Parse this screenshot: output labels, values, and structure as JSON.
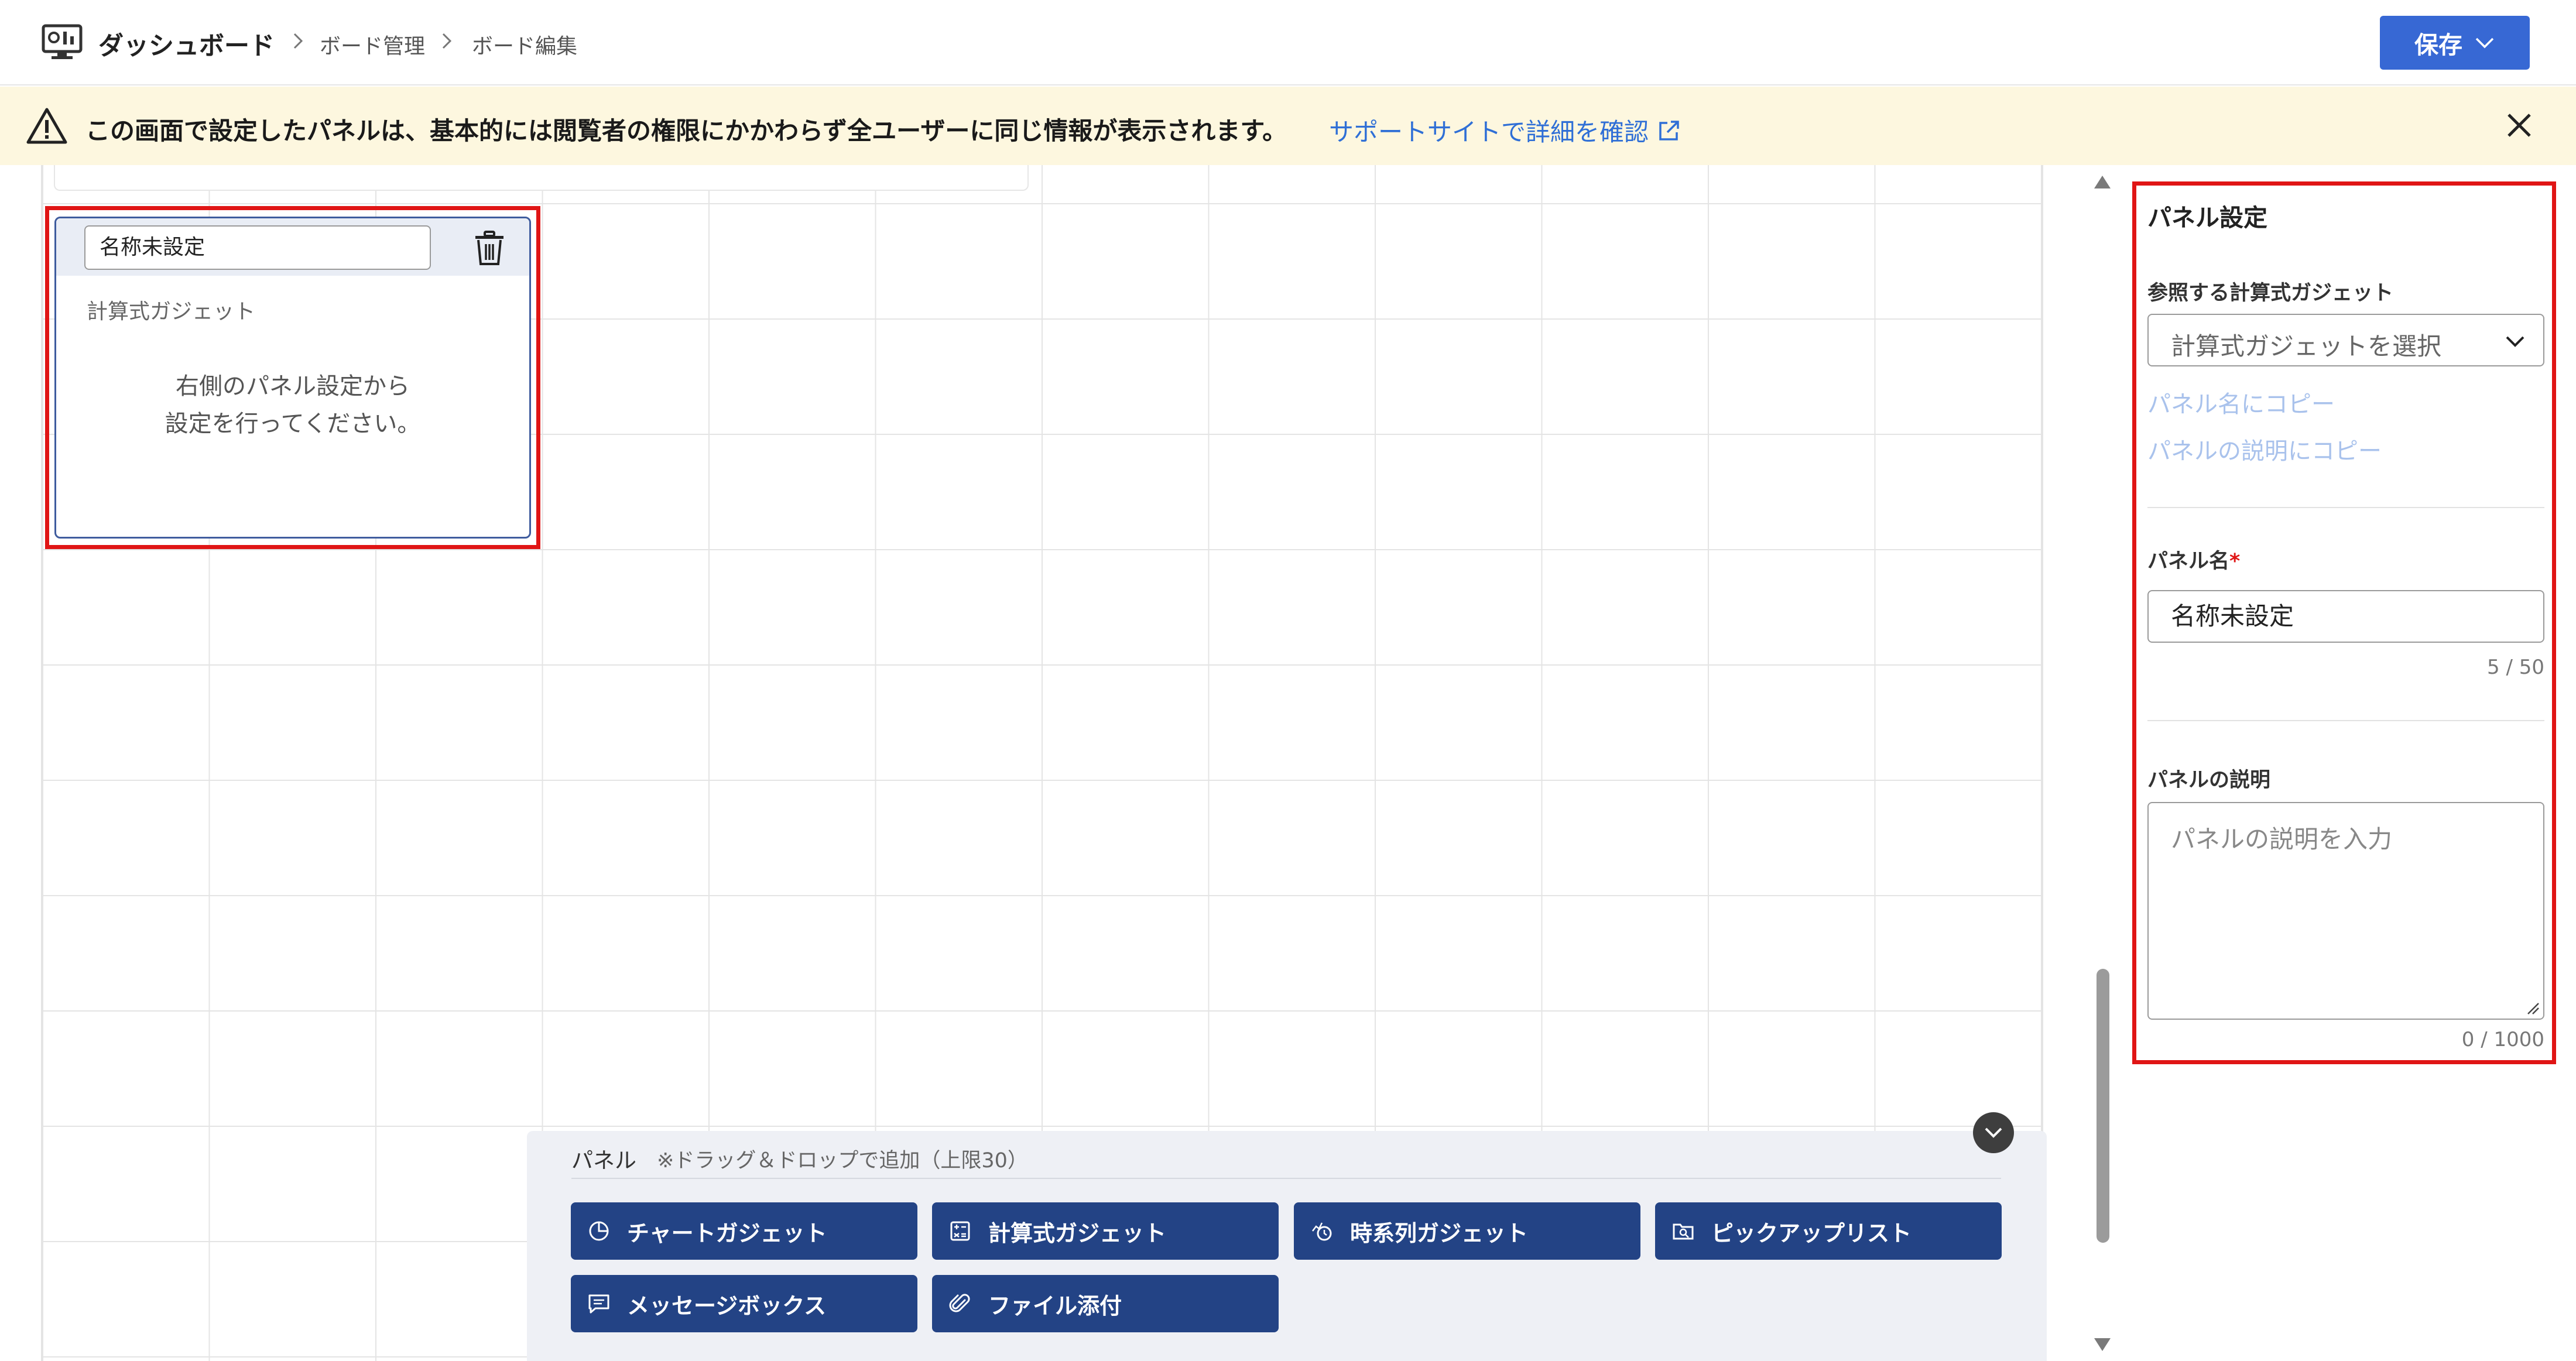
{
  "header": {
    "app_icon": "dashboard-icon",
    "breadcrumb": [
      "ダッシュボード",
      "ボード管理",
      "ボード編集"
    ],
    "save_label": "保存"
  },
  "banner": {
    "message": "この画面で設定したパネルは、基本的には閲覧者の権限にかかわらず全ユーザーに同じ情報が表示されます。",
    "link_text": "サポートサイトで詳細を確認",
    "icons": [
      "warning-icon",
      "external-link-icon",
      "close-icon"
    ]
  },
  "canvas_panel": {
    "name_value": "名称未設定",
    "type_label": "計算式ガジェット",
    "message_line1": "右側のパネル設定から",
    "message_line2": "設定を行ってください。"
  },
  "settings": {
    "title": "パネル設定",
    "gadget_label": "参照する計算式ガジェット",
    "gadget_placeholder": "計算式ガジェットを選択",
    "copy_to_name": "パネル名にコピー",
    "copy_to_description": "パネルの説明にコピー",
    "name_label": "パネル名",
    "required_mark": "*",
    "name_value": "名称未設定",
    "name_counter": "5 / 50",
    "description_label": "パネルの説明",
    "description_placeholder": "パネルの説明を入力",
    "description_counter": "0 / 1000"
  },
  "palette": {
    "title": "パネル",
    "hint": "※ドラッグ＆ドロップで追加（上限30）",
    "buttons": [
      {
        "label": "チャートガジェット",
        "icon": "pie-chart-icon"
      },
      {
        "label": "計算式ガジェット",
        "icon": "calculator-icon"
      },
      {
        "label": "時系列ガジェット",
        "icon": "time-series-icon"
      },
      {
        "label": "ピックアップリスト",
        "icon": "pickup-list-icon"
      },
      {
        "label": "メッセージボックス",
        "icon": "message-icon"
      },
      {
        "label": "ファイル添付",
        "icon": "paperclip-icon"
      }
    ]
  },
  "colors": {
    "primary": "#3768d4",
    "palette_button": "#234385",
    "highlight": "#e01515",
    "banner_bg": "#fdf7df",
    "link": "#2f6fd6"
  }
}
